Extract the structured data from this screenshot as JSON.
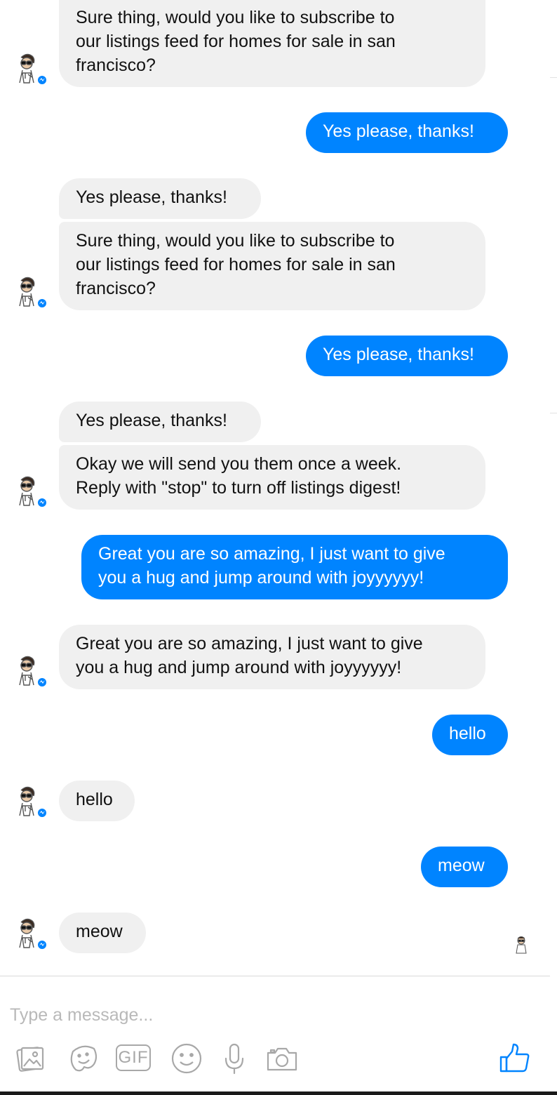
{
  "conversation": {
    "messages": [
      {
        "from": "bot",
        "text": "Sure thing, would you like to subscribe to\nour listings feed for homes for sale in san\nfrancisco?"
      },
      {
        "from": "user",
        "text": "Yes please, thanks!"
      },
      {
        "from": "bot",
        "text": "Yes please, thanks!"
      },
      {
        "from": "bot",
        "text": "Sure thing, would you like to subscribe to\nour listings feed for homes for sale in san\nfrancisco?"
      },
      {
        "from": "user",
        "text": "Yes please, thanks!"
      },
      {
        "from": "bot",
        "text": "Yes please, thanks!"
      },
      {
        "from": "bot",
        "text": "Okay we will send you them once a week.\nReply with \"stop\" to turn off listings digest!"
      },
      {
        "from": "user",
        "text": "Great you are so amazing, I just want to give\nyou a hug and jump around with joyyyyyy!"
      },
      {
        "from": "bot",
        "text": "Great you are so amazing, I just want to give\nyou a hug and jump around with joyyyyyy!"
      },
      {
        "from": "user",
        "text": "hello"
      },
      {
        "from": "bot",
        "text": "hello"
      },
      {
        "from": "user",
        "text": "meow"
      },
      {
        "from": "bot",
        "text": "meow"
      }
    ]
  },
  "composer": {
    "placeholder": "Type a message...",
    "gif_label": "GIF",
    "icons": [
      "photo-icon",
      "sticker-icon",
      "gif-icon",
      "emoji-icon",
      "microphone-icon",
      "camera-icon",
      "thumbs-up-icon"
    ]
  },
  "colors": {
    "outgoing_bubble": "#0084ff",
    "incoming_bubble": "#f0f0f0",
    "icon_gray": "#a8a8a8"
  }
}
